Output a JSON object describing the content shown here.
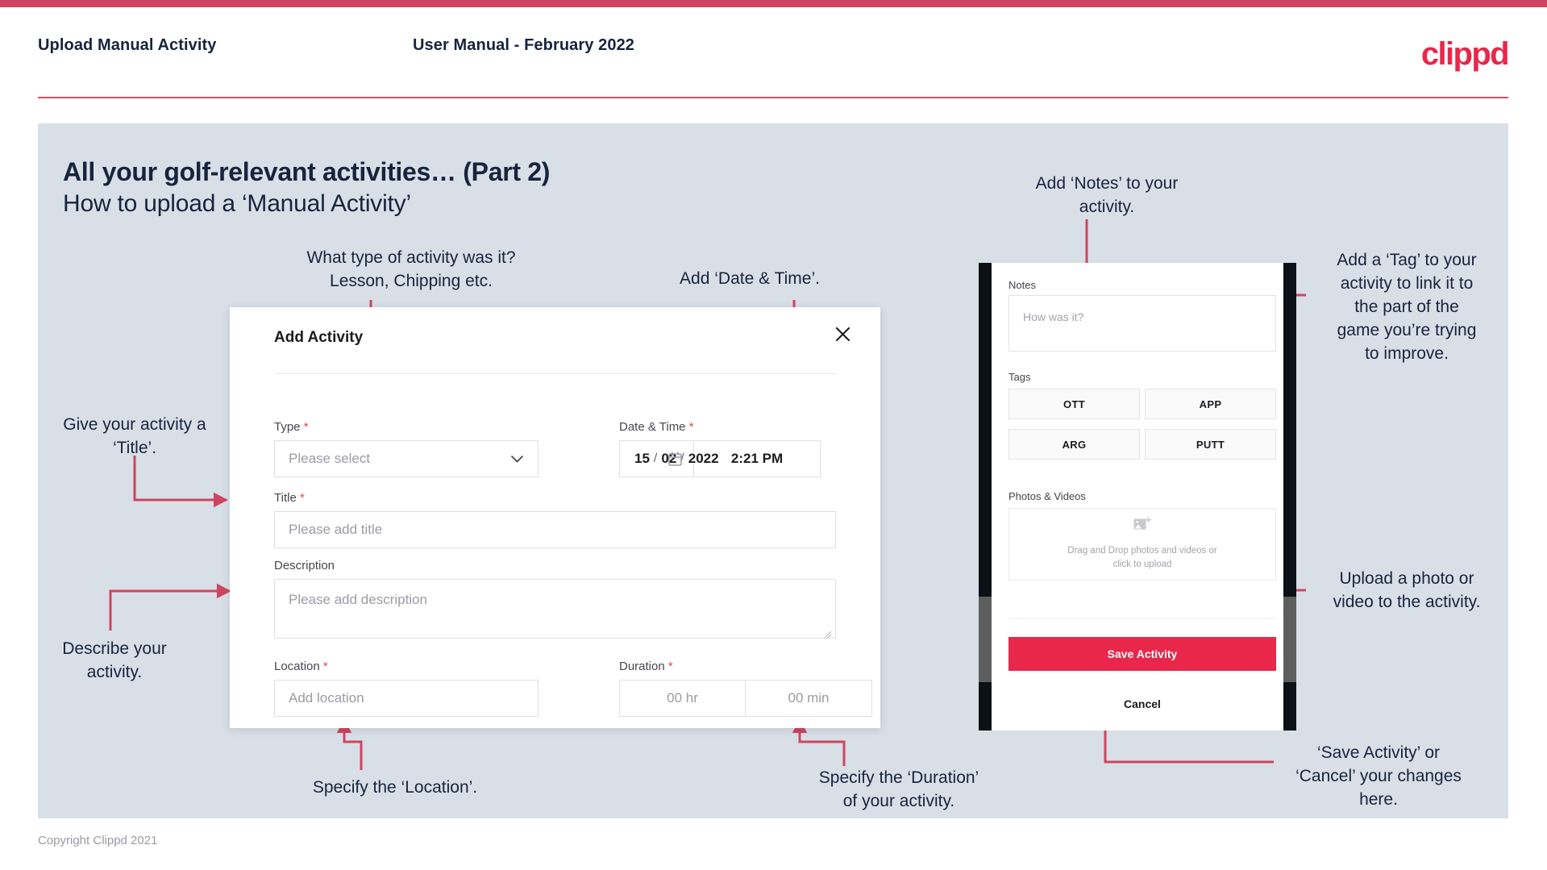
{
  "header": {
    "title": "Upload Manual Activity",
    "subtitle": "User Manual - February 2022",
    "logo": "clippd",
    "accent": "#e8274b",
    "bar_color": "#cf4560"
  },
  "slide": {
    "title": "All your golf-relevant activities… (Part 2)",
    "subtitle": "How to upload a ‘Manual Activity’",
    "panel_bg": "#d9dfe7"
  },
  "dialog": {
    "title": "Add Activity",
    "close_icon": "close-icon",
    "fields": {
      "type": {
        "label": "Type",
        "required": "*",
        "placeholder": "Please select",
        "chevron": "chevron-down-icon"
      },
      "datetime": {
        "label": "Date & Time",
        "required": "*",
        "day": "15",
        "sep1": "/",
        "month": "02",
        "sep2": "/",
        "year": "2022",
        "calendar_icon": "calendar-icon",
        "time": "2:21 PM"
      },
      "title": {
        "label": "Title",
        "required": "*",
        "placeholder": "Please add title"
      },
      "description": {
        "label": "Description",
        "required": "",
        "placeholder": "Please add description"
      },
      "location": {
        "label": "Location",
        "required": "*",
        "placeholder": "Add location"
      },
      "duration": {
        "label": "Duration",
        "required": "*",
        "hours_placeholder": "00 hr",
        "minutes_placeholder": "00 min"
      }
    }
  },
  "phone": {
    "notes": {
      "label": "Notes",
      "placeholder": "How was it?"
    },
    "tags": {
      "label": "Tags",
      "items": [
        "OTT",
        "APP",
        "ARG",
        "PUTT"
      ]
    },
    "photos": {
      "label": "Photos & Videos",
      "icon": "add-image-icon",
      "line1": "Drag and Drop photos and videos or",
      "line2": "click to upload"
    },
    "save_label": "Save Activity",
    "cancel_label": "Cancel",
    "save_color": "#e8274b"
  },
  "annotations": {
    "type": "What type of activity was it?\nLesson, Chipping etc.",
    "datetime": "Add ‘Date & Time’.",
    "title": "Give your activity a\n‘Title’.",
    "description": "Describe your\nactivity.",
    "location": "Specify the ‘Location’.",
    "duration": "Specify the ‘Duration’\nof your activity.",
    "notes": "Add ‘Notes’ to your\nactivity.",
    "tags": "Add a ‘Tag’ to your\nactivity to link it to\nthe part of the\ngame you’re trying\nto improve.",
    "photos": "Upload a photo or\nvideo to the activity.",
    "save": "‘Save Activity’ or\n‘Cancel’ your changes\nhere.",
    "arrow_color": "#cf4560"
  },
  "footer": {
    "copyright": "Copyright Clippd 2021"
  }
}
